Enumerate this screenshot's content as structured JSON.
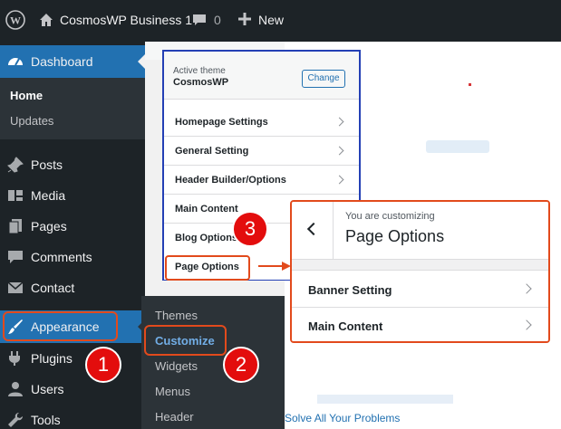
{
  "admin_bar": {
    "site_name": "CosmosWP Business 1",
    "comment_count": "0",
    "new_label": "New"
  },
  "sidebar": {
    "dashboard": "Dashboard",
    "dashboard_sub": [
      "Home",
      "Updates"
    ],
    "items": [
      {
        "label": "Posts",
        "icon": "pin-icon"
      },
      {
        "label": "Media",
        "icon": "media-icon"
      },
      {
        "label": "Pages",
        "icon": "pages-icon"
      },
      {
        "label": "Comments",
        "icon": "comments-icon"
      },
      {
        "label": "Contact",
        "icon": "mail-icon"
      },
      {
        "label": "Appearance",
        "icon": "brush-icon"
      },
      {
        "label": "Plugins",
        "icon": "plug-icon"
      },
      {
        "label": "Users",
        "icon": "user-icon"
      },
      {
        "label": "Tools",
        "icon": "wrench-icon"
      }
    ]
  },
  "appearance_flyout": [
    "Themes",
    "Customize",
    "Widgets",
    "Menus",
    "Header"
  ],
  "customizer": {
    "active_theme_label": "Active theme",
    "theme_name": "CosmosWP",
    "change_label": "Change",
    "sections": [
      "Homepage Settings",
      "General Setting",
      "Header Builder/Options",
      "Main Content",
      "Blog Options",
      "Page Options"
    ]
  },
  "page_options_panel": {
    "customizing_label": "You are customizing",
    "title": "Page Options",
    "sections": [
      "Banner Setting",
      "Main Content"
    ]
  },
  "steps": [
    "1",
    "2",
    "3"
  ],
  "content": {
    "bottom_text": "Solve All Your Problems"
  },
  "colors": {
    "admin_dark": "#1d2327",
    "accent_blue": "#2271b1",
    "highlight_orange": "#e24a1c",
    "badge_red": "#e30d0d",
    "panel_border_blue": "#2440b5"
  }
}
